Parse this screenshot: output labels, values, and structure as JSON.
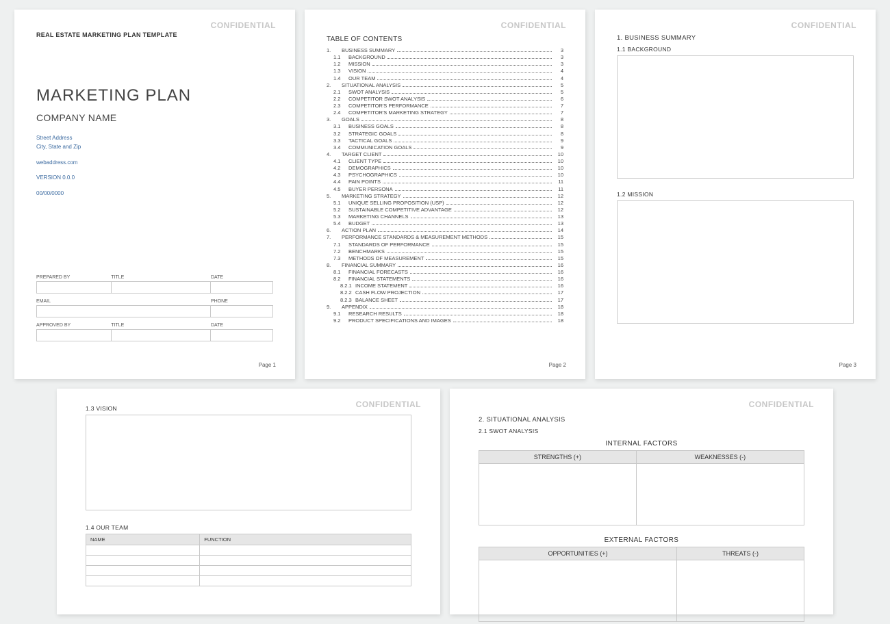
{
  "labels": {
    "confidential": "CONFIDENTIAL",
    "pagePrefix": "Page"
  },
  "page1": {
    "templateTitle": "REAL ESTATE MARKETING PLAN TEMPLATE",
    "mainTitle": "MARKETING PLAN",
    "company": "COMPANY NAME",
    "street": "Street Address",
    "citystate": "City, State and Zip",
    "web": "webaddress.com",
    "version": "VERSION 0.0.0",
    "date": "00/00/0000",
    "sign": {
      "preparedBy": "PREPARED BY",
      "title": "TITLE",
      "date": "DATE",
      "email": "EMAIL",
      "phone": "PHONE",
      "approvedBy": "APPROVED BY"
    },
    "pageNumber": "1"
  },
  "page2": {
    "tocTitle": "TABLE OF CONTENTS",
    "toc": [
      {
        "n": "1.",
        "t": "BUSINESS SUMMARY",
        "p": "3",
        "l": 0
      },
      {
        "n": "1.1",
        "t": "BACKGROUND",
        "p": "3",
        "l": 1
      },
      {
        "n": "1.2",
        "t": "MISSION",
        "p": "3",
        "l": 1
      },
      {
        "n": "1.3",
        "t": "VISION",
        "p": "4",
        "l": 1
      },
      {
        "n": "1.4",
        "t": "OUR TEAM",
        "p": "4",
        "l": 1
      },
      {
        "n": "2.",
        "t": "SITUATIONAL ANALYSIS",
        "p": "5",
        "l": 0
      },
      {
        "n": "2.1",
        "t": "SWOT ANALYSIS",
        "p": "5",
        "l": 1
      },
      {
        "n": "2.2",
        "t": "COMPETITOR SWOT ANALYSIS",
        "p": "6",
        "l": 1
      },
      {
        "n": "2.3",
        "t": "COMPETITOR'S PERFORMANCE",
        "p": "7",
        "l": 1
      },
      {
        "n": "2.4",
        "t": "COMPETITOR'S MARKETING STRATEGY",
        "p": "7",
        "l": 1
      },
      {
        "n": "3.",
        "t": "GOALS",
        "p": "8",
        "l": 0
      },
      {
        "n": "3.1",
        "t": "BUSINESS GOALS",
        "p": "8",
        "l": 1
      },
      {
        "n": "3.2",
        "t": "STRATEGIC GOALS",
        "p": "8",
        "l": 1
      },
      {
        "n": "3.3",
        "t": "TACTICAL GOALS",
        "p": "9",
        "l": 1
      },
      {
        "n": "3.4",
        "t": "COMMUNICATION GOALS",
        "p": "9",
        "l": 1
      },
      {
        "n": "4.",
        "t": "TARGET CLIENT",
        "p": "10",
        "l": 0
      },
      {
        "n": "4.1",
        "t": "CLIENT TYPE",
        "p": "10",
        "l": 1
      },
      {
        "n": "4.2",
        "t": "DEMOGRAPHICS",
        "p": "10",
        "l": 1
      },
      {
        "n": "4.3",
        "t": "PSYCHOGRAPHICS",
        "p": "10",
        "l": 1
      },
      {
        "n": "4.4",
        "t": "PAIN POINTS",
        "p": "11",
        "l": 1
      },
      {
        "n": "4.5",
        "t": "BUYER PERSONA",
        "p": "11",
        "l": 1
      },
      {
        "n": "5.",
        "t": "MARKETING STRATEGY",
        "p": "12",
        "l": 0
      },
      {
        "n": "5.1",
        "t": "UNIQUE SELLING PROPOSITION (USP)",
        "p": "12",
        "l": 1
      },
      {
        "n": "5.2",
        "t": "SUSTAINABLE COMPETITIVE ADVANTAGE",
        "p": "12",
        "l": 1
      },
      {
        "n": "5.3",
        "t": "MARKETING CHANNELS",
        "p": "13",
        "l": 1
      },
      {
        "n": "5.4",
        "t": "BUDGET",
        "p": "13",
        "l": 1
      },
      {
        "n": "6.",
        "t": "ACTION PLAN",
        "p": "14",
        "l": 0
      },
      {
        "n": "7.",
        "t": "PERFORMANCE STANDARDS & MEASUREMENT METHODS",
        "p": "15",
        "l": 0
      },
      {
        "n": "7.1",
        "t": "STANDARDS OF PERFORMANCE",
        "p": "15",
        "l": 1
      },
      {
        "n": "7.2",
        "t": "BENCHMARKS",
        "p": "15",
        "l": 1
      },
      {
        "n": "7.3",
        "t": "METHODS OF MEASUREMENT",
        "p": "15",
        "l": 1
      },
      {
        "n": "8.",
        "t": "FINANCIAL SUMMARY",
        "p": "16",
        "l": 0
      },
      {
        "n": "8.1",
        "t": "FINANCIAL FORECASTS",
        "p": "16",
        "l": 1
      },
      {
        "n": "8.2",
        "t": "FINANCIAL STATEMENTS",
        "p": "16",
        "l": 1
      },
      {
        "n": "8.2.1",
        "t": "INCOME STATEMENT",
        "p": "16",
        "l": 2
      },
      {
        "n": "8.2.2",
        "t": "CASH FLOW PROJECTION",
        "p": "17",
        "l": 2
      },
      {
        "n": "8.2.3",
        "t": "BALANCE SHEET",
        "p": "17",
        "l": 2
      },
      {
        "n": "9.",
        "t": "APPENDIX",
        "p": "18",
        "l": 0
      },
      {
        "n": "9.1",
        "t": "RESEARCH RESULTS",
        "p": "18",
        "l": 1
      },
      {
        "n": "9.2",
        "t": "PRODUCT SPECIFICATIONS AND IMAGES",
        "p": "18",
        "l": 1
      }
    ],
    "pageNumber": "2"
  },
  "page3": {
    "h1": "1. BUSINESS SUMMARY",
    "s11": "1.1  BACKGROUND",
    "s12": "1.2  MISSION",
    "pageNumber": "3"
  },
  "page4": {
    "s13": "1.3  VISION",
    "s14": "1.4  OUR TEAM",
    "teamHeaders": {
      "name": "NAME",
      "function": "FUNCTION"
    }
  },
  "page5": {
    "h1": "2.  SITUATIONAL ANALYSIS",
    "s21": "2.1  SWOT ANALYSIS",
    "internal": "INTERNAL FACTORS",
    "strengths": "STRENGTHS (+)",
    "weaknesses": "WEAKNESSES (-)",
    "external": "EXTERNAL FACTORS",
    "opportunities": "OPPORTUNITIES (+)",
    "threats": "THREATS (-)"
  }
}
